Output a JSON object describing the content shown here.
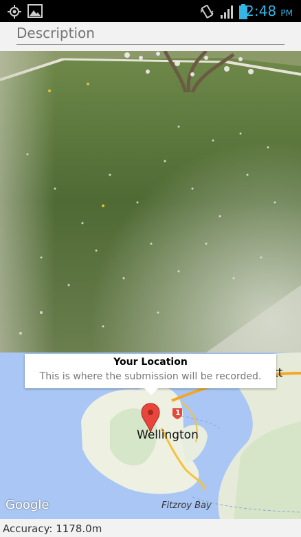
{
  "status_bar": {
    "time": "2:48",
    "ampm": "PM",
    "icons": [
      "gps-icon",
      "image-notification-icon",
      "vibrate-icon",
      "signal-icon",
      "battery-icon"
    ],
    "accent_color": "#33b5e5"
  },
  "form": {
    "description_placeholder": "Description"
  },
  "map": {
    "info_title": "Your Location",
    "info_subtitle": "This is where the submission will be recorded.",
    "city_label": "Wellington",
    "bay_label": "Fitzroy Bay",
    "partial_label": "tt",
    "route_number": "1",
    "google_logo": "Google",
    "marker_color": "#e8453c"
  },
  "footer": {
    "accuracy_text": "Accuracy: 1178.0m"
  }
}
